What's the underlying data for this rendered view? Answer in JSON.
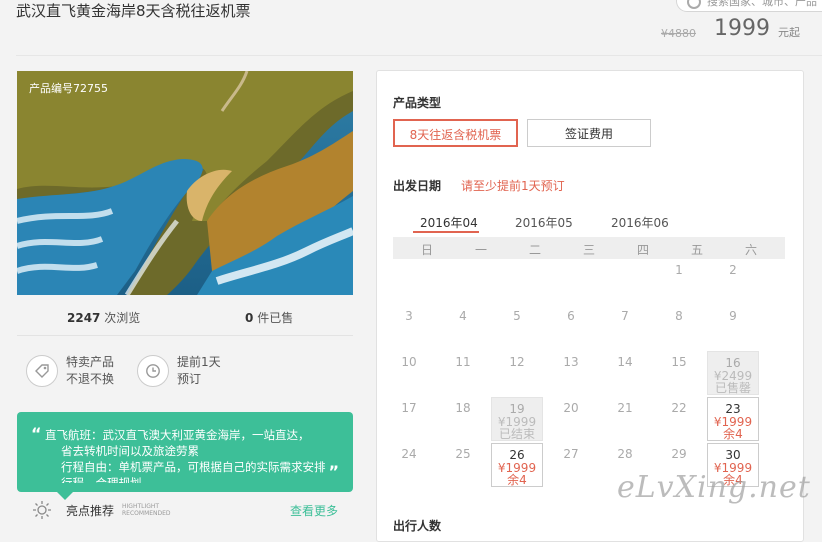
{
  "header": {
    "title": "武汉直飞黄金海岸8天含税往返机票",
    "search_placeholder": "搜索国家、城市、产品",
    "original_price": "¥4880",
    "price": "1999",
    "price_suffix": "元起"
  },
  "product": {
    "id_label": "产品编号72755",
    "views_count": "2247",
    "views_label": "次浏览",
    "sold_count": "0",
    "sold_label": "件已售"
  },
  "features": [
    {
      "icon": "tag-icon",
      "line1": "特卖产品",
      "line2": "不退不换"
    },
    {
      "icon": "clock-icon",
      "line1": "提前1天",
      "line2": "预订"
    }
  ],
  "highlight_box": {
    "open_quote": "“",
    "close_quote": "”",
    "lines": [
      "直飞航班：武汉直飞澳大利亚黄金海岸，一站直达，",
      "省去转机时间以及旅途劳累",
      "行程自由：单机票产品，可根据自己的实际需求安排",
      "行程，合理规划"
    ]
  },
  "highlights": {
    "title": "亮点推荐",
    "en_line1": "HIGHTLIGHT",
    "en_line2": "RECOMMENDED",
    "more_link": "查看更多"
  },
  "booking": {
    "product_type_label": "产品类型",
    "options": [
      {
        "label": "8天往返含税机票",
        "active": true
      },
      {
        "label": "签证费用",
        "active": false
      }
    ],
    "date_label": "出发日期",
    "date_tip": "请至少提前1天预订",
    "months": [
      "2016年04",
      "2016年05",
      "2016年06"
    ],
    "active_month": "2016年04",
    "weekdays": [
      "日",
      "一",
      "二",
      "三",
      "四",
      "五",
      "六"
    ],
    "calendar": [
      [
        null,
        null,
        null,
        null,
        null,
        {
          "d": "1"
        },
        {
          "d": "2"
        }
      ],
      [
        {
          "d": "3"
        },
        {
          "d": "4"
        },
        {
          "d": "5"
        },
        {
          "d": "6"
        },
        {
          "d": "7"
        },
        {
          "d": "8"
        },
        {
          "d": "9"
        }
      ],
      [
        {
          "d": "10"
        },
        {
          "d": "11"
        },
        {
          "d": "12"
        },
        {
          "d": "13"
        },
        {
          "d": "14"
        },
        {
          "d": "15"
        },
        {
          "d": "16",
          "state": "grey",
          "price": "¥2499",
          "note": "已售罄"
        }
      ],
      [
        {
          "d": "17"
        },
        {
          "d": "18"
        },
        {
          "d": "19",
          "state": "grey",
          "price": "¥1999",
          "note": "已结束"
        },
        {
          "d": "20"
        },
        {
          "d": "21"
        },
        {
          "d": "22"
        },
        {
          "d": "23",
          "state": "avail",
          "price": "¥1999",
          "note": "余4"
        }
      ],
      [
        {
          "d": "24"
        },
        {
          "d": "25"
        },
        {
          "d": "26",
          "state": "avail",
          "price": "¥1999",
          "note": "余4"
        },
        {
          "d": "27"
        },
        {
          "d": "28"
        },
        {
          "d": "29"
        },
        {
          "d": "30",
          "state": "avail",
          "price": "¥1999",
          "note": "余4"
        }
      ]
    ],
    "travelers_label": "出行人数"
  },
  "watermark": "eLvXing.net",
  "colors": {
    "accent": "#e16450",
    "green": "#3dbf98"
  }
}
